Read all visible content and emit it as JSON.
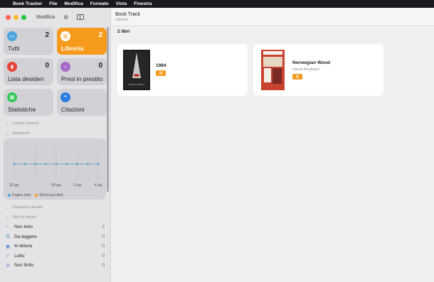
{
  "menubar": {
    "app": "Book Tracker",
    "items": [
      "File",
      "Modifica",
      "Formato",
      "Vista",
      "Finestra"
    ]
  },
  "sidebar": {
    "toolbar_label": "Modifica",
    "tiles": [
      {
        "label": "Tutti",
        "count": "2",
        "icon": "tray-icon",
        "color": "#4aa3df"
      },
      {
        "label": "Libreria",
        "count": "2",
        "icon": "books-icon",
        "color": "#f59a1d",
        "active": true
      },
      {
        "label": "Lista desideri",
        "count": "0",
        "icon": "bookmark-icon",
        "color": "#e8443a"
      },
      {
        "label": "Presi in prestito",
        "count": "0",
        "icon": "bank-icon",
        "color": "#a56ac8"
      },
      {
        "label": "Statistiche",
        "count": "",
        "icon": "chart-icon",
        "color": "#34c759"
      },
      {
        "label": "Citazioni",
        "count": "",
        "icon": "quote-icon",
        "color": "#2f7de1"
      }
    ],
    "sections": {
      "current": "Letture correnti",
      "stats": "Statistiche",
      "quote": "Citazione casuale",
      "status": "Stati di lettura"
    },
    "chart_data": {
      "type": "line",
      "x": [
        "26 giu",
        "27 giu",
        "28 giu",
        "29 giu",
        "30 giu",
        "1 lug",
        "2 lug",
        "3 lug",
        "4 lug"
      ],
      "tick_labels": [
        "26 giu",
        "30 giu",
        "2 lug",
        "4 lug"
      ],
      "series": [
        {
          "name": "Pagine lette",
          "values": [
            0,
            0,
            0,
            0,
            0,
            0,
            0,
            0,
            0
          ],
          "color": "#4aa3df"
        },
        {
          "name": "Minuti ascoltati",
          "values": [
            0,
            0,
            0,
            0,
            0,
            0,
            0,
            0,
            0
          ],
          "color": "#f59a1d"
        }
      ],
      "grid": true
    },
    "statuses": [
      {
        "label": "Non letto",
        "count": "2",
        "icon": "circle-icon"
      },
      {
        "label": "Da leggere",
        "count": "0",
        "icon": "list-icon"
      },
      {
        "label": "In lettura",
        "count": "0",
        "icon": "eye-icon"
      },
      {
        "label": "Letto",
        "count": "0",
        "icon": "checkmark-icon"
      },
      {
        "label": "Non finito",
        "count": "0",
        "icon": "prohibited-icon"
      }
    ]
  },
  "main": {
    "title": "Book Track",
    "subtitle": "Libreria",
    "count": "2 libri",
    "books": [
      {
        "title": "1984",
        "author": "",
        "cover_text": "GEORGE ORWELL",
        "badge": "books-icon"
      },
      {
        "title": "Norwegian Wood",
        "author": "Haruki Murakami",
        "badge": "books-icon"
      }
    ]
  }
}
